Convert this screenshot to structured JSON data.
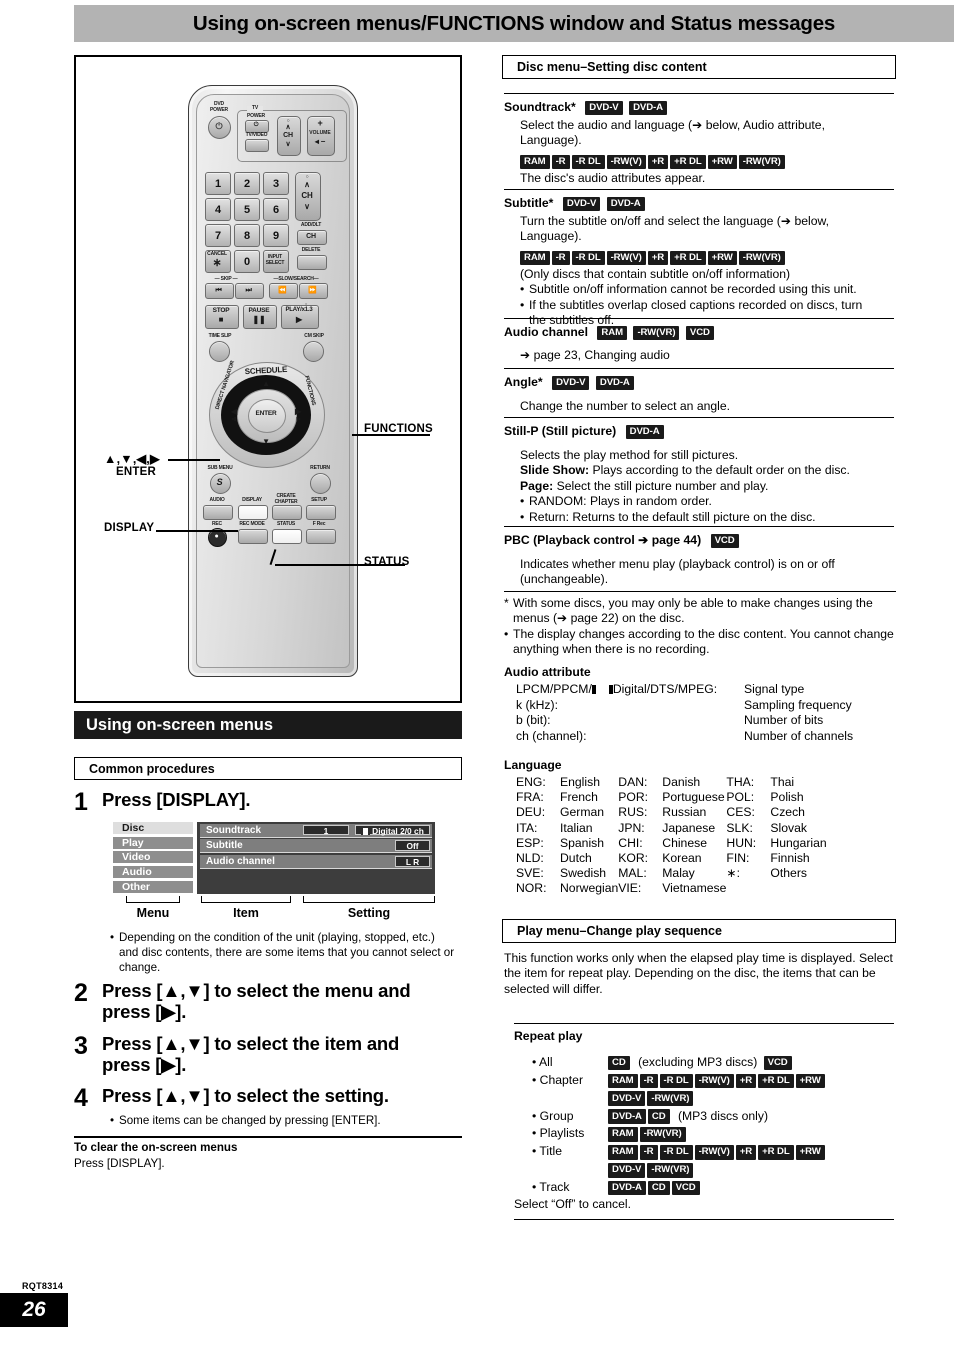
{
  "header": {
    "title": "Using on-screen menus/FUNCTIONS window and Status messages"
  },
  "remote": {
    "labels": {
      "dvd_power": "DVD\nPOWER",
      "tv": "TV",
      "tv_power": "POWER",
      "tv_video": "TV/VIDEO",
      "ch": "CH",
      "volume": "VOLUME",
      "add_dlt": "ADD/DLT",
      "add_dlt_ch": "CH",
      "delete": "DELETE",
      "cancel": "CANCEL",
      "cancel_star": "∗",
      "input_select": "INPUT\nSELECT",
      "skip": "SKIP",
      "slow_search": "SLOW/SEARCH",
      "stop": "STOP",
      "pause": "PAUSE",
      "play": "PLAY/x1.3",
      "time_slip": "TIME SLIP",
      "cm_skip": "CM SKIP",
      "schedule": "SCHEDULE",
      "direct_navigator": "DIRECT NAVIGATOR",
      "functions_ring": "FUNCTIONS",
      "enter": "ENTER",
      "sub_menu": "SUB MENU",
      "sub_menu_s": "S",
      "return": "RETURN",
      "audio": "AUDIO",
      "display": "DISPLAY",
      "create_chapter": "CREATE\nCHAPTER",
      "setup": "SETUP",
      "rec": "REC",
      "rec_mode": "REC MODE",
      "status": "STATUS",
      "f_rec": "F Rec",
      "numbers": [
        "1",
        "2",
        "3",
        "4",
        "5",
        "6",
        "7",
        "8",
        "9",
        "0"
      ]
    },
    "callouts": {
      "functions": "FUNCTIONS",
      "arrows": "▲,▼,◀,▶",
      "enter": "ENTER",
      "display": "DISPLAY",
      "status": "STATUS"
    }
  },
  "left": {
    "section_title": "Using on-screen menus",
    "common_procedures": "Common procedures",
    "steps": [
      {
        "num": "1",
        "text": "Press [DISPLAY]."
      },
      {
        "num": "2",
        "text": "Press [▲,▼] to select the menu and press [▶]."
      },
      {
        "num": "3",
        "text": "Press [▲,▼] to select the item and press [▶]."
      },
      {
        "num": "4",
        "text": "Press [▲,▼] to select the setting."
      }
    ],
    "note_after_step1": "Depending on the condition of the unit (playing, stopped, etc.) and disc contents, there are some items that you cannot select or change.",
    "note_after_step4": "Some items can be changed by pressing [ENTER].",
    "clear_heading": "To clear the on-screen menus",
    "clear_body": "Press [DISPLAY].",
    "osd": {
      "menu_items": [
        "Disc",
        "Play",
        "Video",
        "Audio",
        "Other"
      ],
      "selected_menu": "Disc",
      "rows": [
        {
          "label": "Soundtrack",
          "value1": "1",
          "value2": "Digital  2/0 ch"
        },
        {
          "label": "Subtitle",
          "value1": "Off"
        },
        {
          "label": "Audio channel",
          "value1": "L R"
        }
      ],
      "captions": {
        "menu": "Menu",
        "item": "Item",
        "setting": "Setting"
      }
    }
  },
  "right": {
    "disc_menu_heading": "Disc menu–Setting disc content",
    "entries": [
      {
        "title": "Soundtrack*",
        "title_chips": [
          "DVD-V",
          "DVD-A"
        ],
        "body": "Select the audio and language (➔ below, Audio attribute, Language).",
        "chips": [
          "RAM",
          "-R",
          "-R DL",
          "-RW(V)",
          "+R",
          "+R DL",
          "+RW",
          "-RW(VR)"
        ],
        "body2": "The disc's audio attributes appear."
      },
      {
        "title": "Subtitle*",
        "title_chips": [
          "DVD-V",
          "DVD-A"
        ],
        "body": "Turn the subtitle on/off and select the language (➔ below, Language).",
        "chips": [
          "RAM",
          "-R",
          "-R DL",
          "-RW(V)",
          "+R",
          "+R DL",
          "+RW",
          "-RW(VR)"
        ],
        "body2": "(Only discs that contain subtitle on/off information)",
        "bullets": [
          "Subtitle on/off information cannot be recorded using this unit.",
          "If the subtitles overlap closed captions recorded on discs, turn the subtitles off."
        ]
      },
      {
        "title": "Audio channel",
        "title_chips": [
          "RAM",
          "-RW(VR)",
          "VCD"
        ],
        "body": "➔ page 23, Changing audio"
      },
      {
        "title": "Angle*",
        "title_chips": [
          "DVD-V",
          "DVD-A"
        ],
        "body": "Change the number to select an angle."
      },
      {
        "title": "Still-P (Still picture)",
        "title_chips": [
          "DVD-A"
        ],
        "body": "Selects the play method for still pictures.",
        "defs": [
          {
            "term": "Slide Show:",
            "desc": " Plays according to the default order on the disc."
          },
          {
            "term": "Page:",
            "desc": " Select the still picture number and play."
          }
        ],
        "bullets": [
          "RANDOM: Plays in random order.",
          "Return: Returns to the default still picture on the disc."
        ]
      },
      {
        "title": "PBC (Playback control ➔ page 44)",
        "title_chips": [
          "VCD"
        ],
        "body": "Indicates whether menu play (playback control) is on or off (unchangeable)."
      }
    ],
    "footnotes": [
      {
        "mark": "*",
        "text": "With some discs, you may only be able to make changes using the menus (➔ page 22) on the disc."
      },
      {
        "mark": "•",
        "text": "The display changes according to the disc content. You cannot change anything when there is no recording."
      }
    ],
    "audio_attribute": {
      "heading": "Audio attribute",
      "rows": [
        {
          "left": "LPCM/PPCM/ Digital/DTS/MPEG:",
          "right": "Signal type",
          "has_dd": true
        },
        {
          "left": "k (kHz):",
          "right": "Sampling frequency"
        },
        {
          "left": "b (bit):",
          "right": "Number of bits"
        },
        {
          "left": "ch (channel):",
          "right": "Number of channels"
        }
      ]
    },
    "language": {
      "heading": "Language",
      "columns": [
        [
          {
            "code": "ENG:",
            "name": "English"
          },
          {
            "code": "FRA:",
            "name": "French"
          },
          {
            "code": "DEU:",
            "name": "German"
          },
          {
            "code": "ITA:",
            "name": "Italian"
          },
          {
            "code": "ESP:",
            "name": "Spanish"
          },
          {
            "code": "NLD:",
            "name": "Dutch"
          },
          {
            "code": "SVE:",
            "name": "Swedish"
          },
          {
            "code": "NOR:",
            "name": "Norwegian"
          }
        ],
        [
          {
            "code": "DAN:",
            "name": "Danish"
          },
          {
            "code": "POR:",
            "name": "Portuguese"
          },
          {
            "code": "RUS:",
            "name": "Russian"
          },
          {
            "code": "JPN:",
            "name": "Japanese"
          },
          {
            "code": "CHI:",
            "name": "Chinese"
          },
          {
            "code": "KOR:",
            "name": "Korean"
          },
          {
            "code": "MAL:",
            "name": "Malay"
          },
          {
            "code": "VIE:",
            "name": "Vietnamese"
          }
        ],
        [
          {
            "code": "THA:",
            "name": "Thai"
          },
          {
            "code": "POL:",
            "name": "Polish"
          },
          {
            "code": "CES:",
            "name": "Czech"
          },
          {
            "code": "SLK:",
            "name": "Slovak"
          },
          {
            "code": "HUN:",
            "name": "Hungarian"
          },
          {
            "code": "FIN:",
            "name": "Finnish"
          },
          {
            "code": "∗:",
            "name": "Others"
          }
        ]
      ]
    },
    "play_menu": {
      "heading": "Play menu–Change play sequence",
      "intro": "This function works only when the elapsed play time is displayed. Select the item for repeat play. Depending on the disc, the items that can be selected will differ.",
      "repeat_heading": "Repeat play",
      "rows": [
        {
          "label": "• All",
          "chips": [
            "CD"
          ],
          "mid": "(excluding MP3 discs)",
          "chips2": [
            "VCD"
          ]
        },
        {
          "label": "• Chapter",
          "chips": [
            "RAM",
            "-R",
            "-R DL",
            "-RW(V)",
            "+R",
            "+R DL",
            "+RW",
            "DVD-V",
            "-RW(VR)"
          ]
        },
        {
          "label": "• Group",
          "chips": [
            "DVD-A",
            "CD"
          ],
          "mid": "(MP3 discs only)"
        },
        {
          "label": "• Playlists",
          "chips": [
            "RAM",
            "-RW(VR)"
          ]
        },
        {
          "label": "• Title",
          "chips": [
            "RAM",
            "-R",
            "-R DL",
            "-RW(V)",
            "+R",
            "+R DL",
            "+RW",
            "DVD-V",
            "-RW(VR)"
          ]
        },
        {
          "label": "• Track",
          "chips": [
            "DVD-A",
            "CD",
            "VCD"
          ]
        }
      ],
      "cancel_note": "Select “Off” to cancel."
    }
  },
  "footer": {
    "code": "RQT8314",
    "page": "26"
  }
}
